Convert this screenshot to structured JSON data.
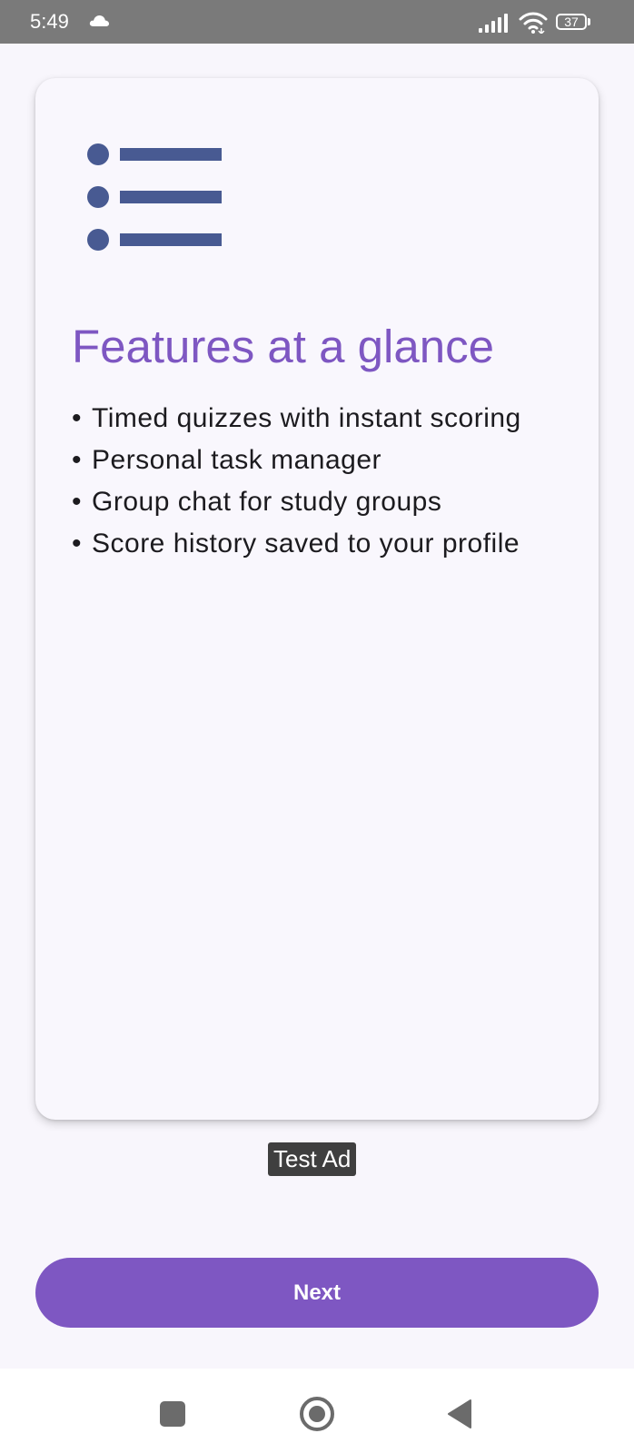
{
  "status_bar": {
    "time": "5:49",
    "battery_level": "37",
    "icons": [
      "cloud-icon",
      "signal-icon",
      "wifi-icon",
      "battery-icon"
    ]
  },
  "card": {
    "icon": "list-icon",
    "title": "Features at a glance",
    "features": [
      "Timed quizzes with instant scoring",
      "Personal task manager",
      "Group chat for study groups",
      "Score history saved to your profile"
    ],
    "bullet": "•"
  },
  "ad": {
    "label": "Test Ad"
  },
  "next_button": {
    "label": "Next"
  },
  "nav_bar": {
    "icons": [
      "recents-icon",
      "home-icon",
      "back-icon"
    ]
  },
  "colors": {
    "accent": "#7e57c2",
    "list_icon": "#485a92",
    "status_bar": "#7a7a7a",
    "background": "#f8f6fc"
  }
}
